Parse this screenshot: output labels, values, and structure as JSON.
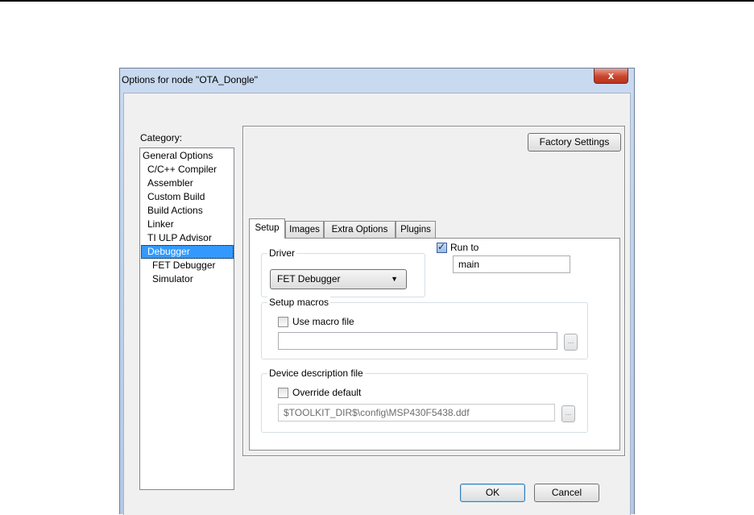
{
  "window": {
    "title": "Options for node \"OTA_Dongle\"",
    "close_glyph": "x",
    "close_icon": "close-icon"
  },
  "category": {
    "label": "Category:",
    "selected_index": 7,
    "items": [
      {
        "label": "General Options",
        "indent": 0
      },
      {
        "label": "C/C++ Compiler",
        "indent": 1
      },
      {
        "label": "Assembler",
        "indent": 1
      },
      {
        "label": "Custom Build",
        "indent": 1
      },
      {
        "label": "Build Actions",
        "indent": 1
      },
      {
        "label": "Linker",
        "indent": 1
      },
      {
        "label": "TI ULP Advisor",
        "indent": 1
      },
      {
        "label": "Debugger",
        "indent": 1
      },
      {
        "label": "FET Debugger",
        "indent": 2
      },
      {
        "label": "Simulator",
        "indent": 2
      }
    ]
  },
  "panel": {
    "factory_settings_label": "Factory Settings",
    "tabs": [
      {
        "label": "Setup",
        "active": true
      },
      {
        "label": "Images",
        "active": false
      },
      {
        "label": "Extra Options",
        "active": false
      },
      {
        "label": "Plugins",
        "active": false
      }
    ],
    "driver": {
      "group_title": "Driver",
      "selected_value": "FET Debugger"
    },
    "run_to": {
      "label": "Run to",
      "checked": true,
      "value": "main"
    },
    "setup_macros": {
      "group_title": "Setup macros",
      "checkbox_label": "Use macro file",
      "checked": false,
      "value": "",
      "browse_label": "..."
    },
    "device_description": {
      "group_title": "Device description file",
      "checkbox_label": "Override default",
      "checked": false,
      "value": "$TOOLKIT_DIR$\\config\\MSP430F5438.ddf",
      "browse_label": "..."
    }
  },
  "buttons": {
    "ok_label": "OK",
    "cancel_label": "Cancel"
  },
  "colors": {
    "selection": "#3399ff",
    "close_button": "#c9452d",
    "title_bar": "#c9daf0"
  }
}
